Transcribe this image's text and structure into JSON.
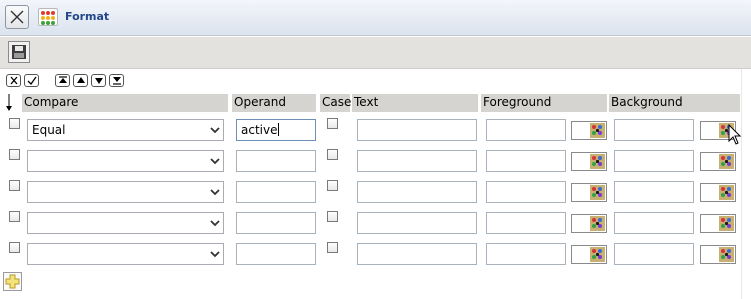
{
  "window": {
    "title": "Format"
  },
  "table": {
    "headers": {
      "compare": "Compare",
      "operand": "Operand",
      "case": "Case",
      "text": "Text",
      "foreground": "Foreground",
      "background": "Background"
    },
    "rows": [
      {
        "compare": "Equal",
        "operand": "active",
        "case": false,
        "text": "",
        "foreground": "",
        "background": ""
      },
      {
        "compare": "",
        "operand": "",
        "case": false,
        "text": "",
        "foreground": "",
        "background": ""
      },
      {
        "compare": "",
        "operand": "",
        "case": false,
        "text": "",
        "foreground": "",
        "background": ""
      },
      {
        "compare": "",
        "operand": "",
        "case": false,
        "text": "",
        "foreground": "",
        "background": ""
      },
      {
        "compare": "",
        "operand": "",
        "case": false,
        "text": "",
        "foreground": "",
        "background": ""
      }
    ]
  },
  "icons": {
    "close": "close-icon",
    "app": "format-palette-icon",
    "save": "floppy-disk-icon",
    "select_all": "select-all-icon",
    "deselect_all": "deselect-all-icon",
    "move_top": "move-top-icon",
    "move_up": "move-up-icon",
    "move_down": "move-down-icon",
    "move_bottom": "move-bottom-icon",
    "sort": "sort-arrow-icon",
    "color_picker": "color-palette-icon",
    "add": "add-icon"
  },
  "colors": {
    "title_text": "#23478a",
    "header_bg": "#d6d4d0",
    "toolbar_bg": "#e4e2de"
  }
}
